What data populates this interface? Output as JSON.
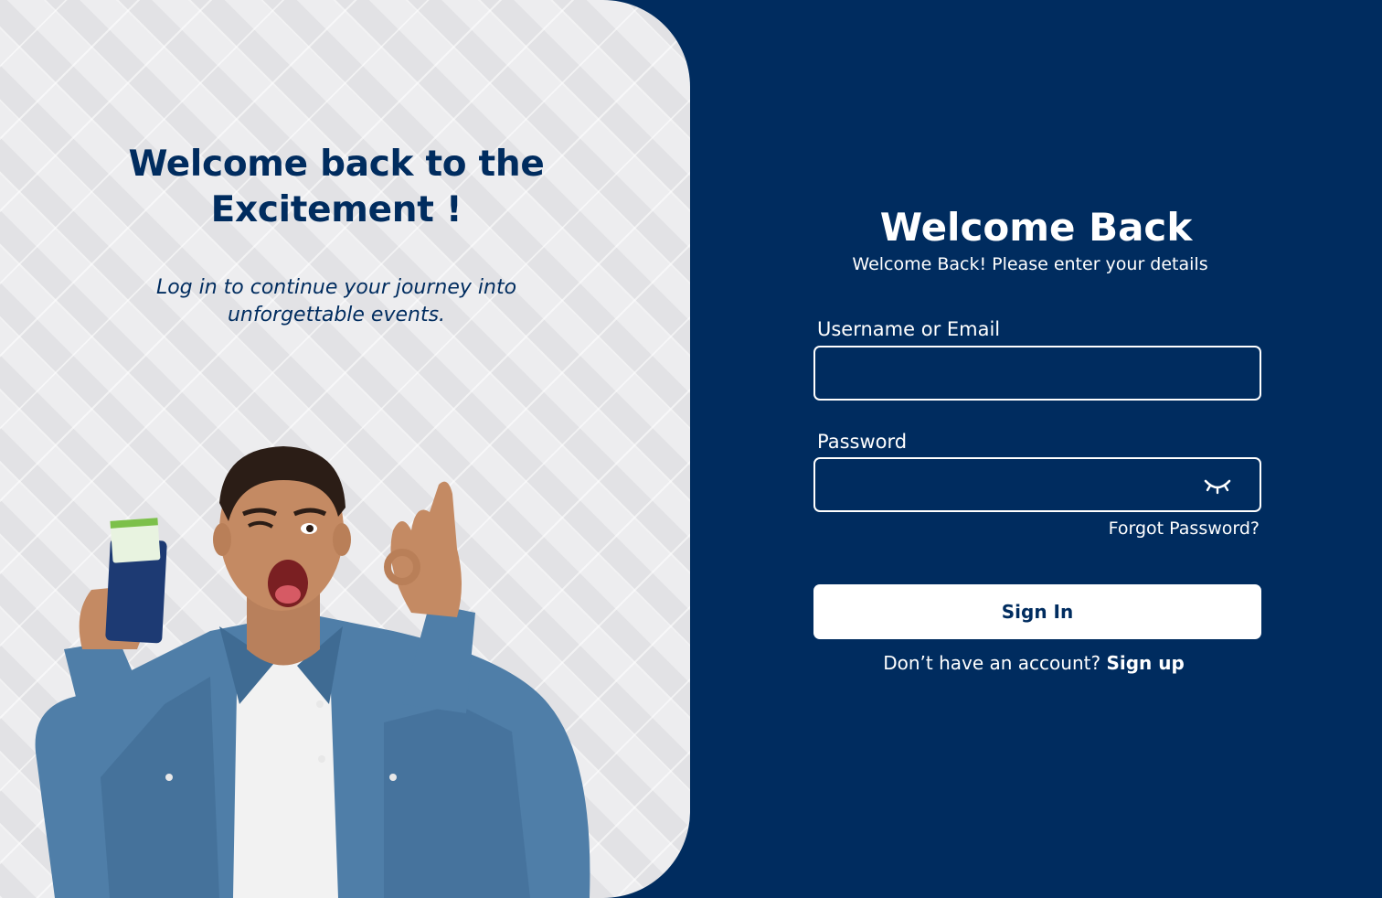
{
  "hero": {
    "title": "Welcome back to the Excitement !",
    "subtitle": "Log in to continue your journey into unforgettable events."
  },
  "login": {
    "title": "Welcome Back",
    "subtitle": "Welcome Back! Please enter your details",
    "username_label": "Username or Email",
    "username_value": "",
    "password_label": "Password",
    "password_value": "",
    "password_toggle_icon": "eye-closed-icon",
    "forgot_password": "Forgot Password?",
    "signin_button": "Sign In",
    "signup_prompt": "Don’t have an account?",
    "signup_link": "Sign up"
  },
  "colors": {
    "brand_navy": "#002c5f",
    "hero_background": "#ebebed",
    "white": "#ffffff"
  }
}
